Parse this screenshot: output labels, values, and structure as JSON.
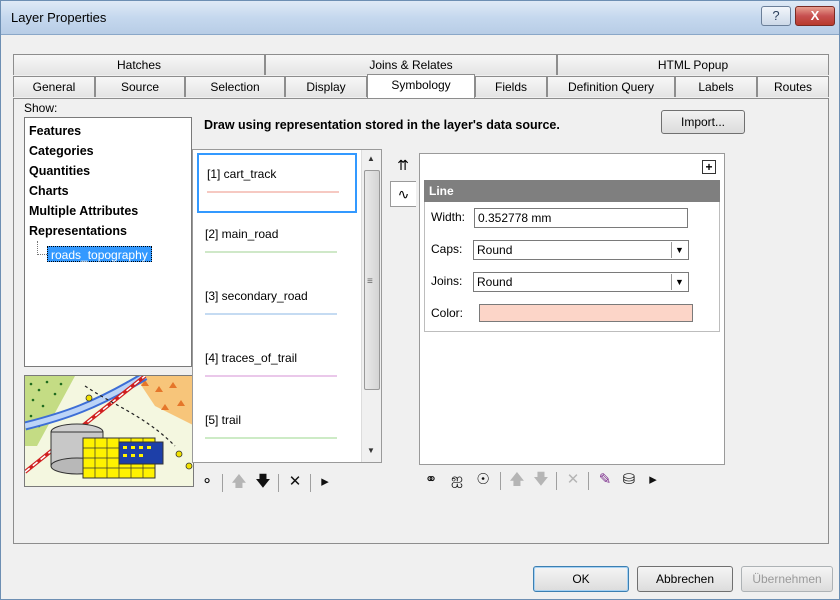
{
  "window": {
    "title": "Layer Properties",
    "help_glyph": "?",
    "close_glyph": "X"
  },
  "tabs_back": [
    {
      "label": "Hatches"
    },
    {
      "label": "Joins & Relates"
    },
    {
      "label": "HTML Popup"
    }
  ],
  "tabs_front": [
    {
      "label": "General"
    },
    {
      "label": "Source"
    },
    {
      "label": "Selection"
    },
    {
      "label": "Display"
    },
    {
      "label": "Symbology",
      "active": true
    },
    {
      "label": "Fields"
    },
    {
      "label": "Definition Query"
    },
    {
      "label": "Labels"
    },
    {
      "label": "Routes"
    }
  ],
  "show": {
    "label": "Show:",
    "items": [
      "Features",
      "Categories",
      "Quantities",
      "Charts",
      "Multiple Attributes",
      "Representations"
    ],
    "selected_sub": "roads_topography"
  },
  "symbology": {
    "description": "Draw using representation stored in the layer's data source.",
    "import_label": "Import..."
  },
  "representations": [
    {
      "label": "[1] cart_track",
      "color": "#f6c9c2"
    },
    {
      "label": "[2] main_road",
      "color": "#cfe8c8"
    },
    {
      "label": "[3] secondary_road",
      "color": "#c5dbf2"
    },
    {
      "label": "[4] traces_of_trail",
      "color": "#eac8ea"
    },
    {
      "label": "[5] trail",
      "color": "#cdebc6"
    }
  ],
  "line_props": {
    "header": "Line",
    "plus_glyph": "+",
    "width_label": "Width:",
    "width_value": "0.352778 mm",
    "caps_label": "Caps:",
    "caps_value": "Round",
    "joins_label": "Joins:",
    "joins_value": "Round",
    "color_label": "Color:",
    "color_value": "#fcd5c8"
  },
  "buttons": {
    "ok": "OK",
    "cancel": "Abbrechen",
    "apply": "Übernehmen"
  },
  "icons": {
    "list_toolbar": [
      "add-icon",
      "move-up-icon",
      "move-down-icon",
      "delete-icon",
      "more-icon"
    ],
    "props_toolbar": [
      "add-rule-icon",
      "add-geometric-effect-icon",
      "add-marker-icon",
      "move-up-icon",
      "move-down-icon",
      "delete-icon",
      "edit-icon",
      "database-icon",
      "more-icon"
    ]
  }
}
